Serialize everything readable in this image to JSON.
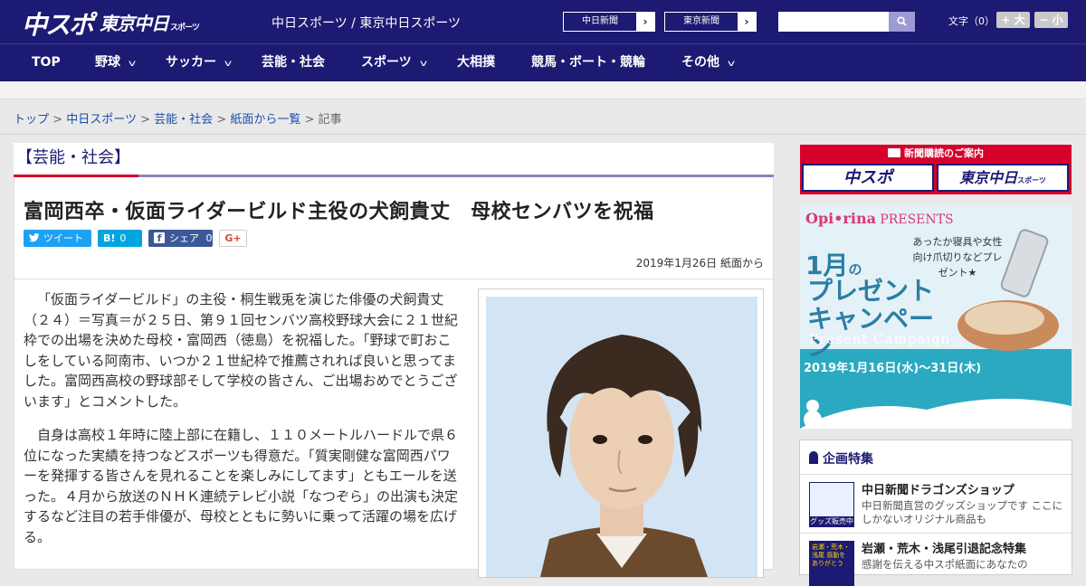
{
  "header": {
    "logo_chunichi": "中スポ",
    "logo_tokyo": "東京中日",
    "logo_tokyo_sub": "スポーツ",
    "site_name": "中日スポーツ / 東京中日スポーツ",
    "links": [
      {
        "label": "中日新聞",
        "arrow": "›"
      },
      {
        "label": "東京新聞",
        "arrow": "›"
      }
    ],
    "search_placeholder": "",
    "font_size_label": "文字（0）",
    "font_larger": "+ 大",
    "font_smaller": "− 小"
  },
  "nav": [
    {
      "label": "TOP",
      "has_menu": false
    },
    {
      "label": "野球",
      "has_menu": true
    },
    {
      "label": "サッカー",
      "has_menu": true
    },
    {
      "label": "芸能・社会",
      "has_menu": false
    },
    {
      "label": "スポーツ",
      "has_menu": true
    },
    {
      "label": "大相撲",
      "has_menu": false
    },
    {
      "label": "競馬・ボート・競輪",
      "has_menu": false
    },
    {
      "label": "その他",
      "has_menu": true
    }
  ],
  "breadcrumb": {
    "items": [
      "トップ",
      "中日スポーツ",
      "芸能・社会",
      "紙面から一覧"
    ],
    "current": "記事",
    "separator": ">"
  },
  "category_title": "【芸能・社会】",
  "article": {
    "title": "富岡西卒・仮面ライダービルド主役の犬飼貴丈　母校センバツを祝福",
    "share": {
      "tweet": {
        "icon": "twitter-bird",
        "label": "ツイート",
        "color": "#1da1f2"
      },
      "hatena": {
        "icon": "B!",
        "count": "0",
        "color": "#00a4de"
      },
      "facebook": {
        "icon": "f",
        "label": "シェア",
        "count": "0",
        "color": "#3b5998"
      },
      "gplus": {
        "label": "G+"
      }
    },
    "date": "2019年1月26日 紙面から",
    "paragraphs": [
      "「仮面ライダービルド」の主役・桐生戦兎を演じた俳優の犬飼貴丈（２４）＝写真＝が２５日、第９１回センバツ高校野球大会に２１世紀枠での出場を決めた母校・富岡西（徳島）を祝福した。「野球で町おこしをしている阿南市、いつか２１世紀枠で推薦されれば良いと思ってました。富岡西高校の野球部そして学校の皆さん、ご出場おめでとうございます」とコメントした。",
      "自身は高校１年時に陸上部に在籍し、１１０メートルハードルで県６位になった実績を持つなどスポーツも得意だ。「質実剛健な富岡西パワーを発揮する皆さんを見れることを楽しみにしてます」ともエールを送った。４月から放送のＮＨＫ連続テレビ小説「なつぞら」の出演も決定するなど注目の若手俳優が、母校とともに勢いに乗って活躍の場を広げる。"
    ]
  },
  "sidebar": {
    "subscribe": {
      "header": "新聞購読のご案内",
      "left": "中スポ",
      "right": "東京中日",
      "right_sub": "スポーツ"
    },
    "promo": {
      "brand": "Opi•rina",
      "brand_tail": "PRESENTS",
      "tagline": "あったか寝具や女性向け爪切りなどプレゼント★",
      "month": "1月",
      "month_tail": "の",
      "headline": "プレゼントキャンペーン",
      "english": "Present Campaign",
      "period": "2019年1月16日(水)〜31日(木)"
    },
    "features": {
      "heading": "企画特集",
      "items": [
        {
          "name": "中日新聞ドラゴンズショップ",
          "desc": "中日新聞直営のグッズショップです ここにしかないオリジナル商品も",
          "thumb": "グッズ販売中"
        },
        {
          "name": "岩瀬・荒木・浅尾引退記念特集",
          "desc": "感謝を伝える中スポ紙面にあなたの",
          "thumb": "岩瀬・荒木・浅尾 感動をありがとう"
        }
      ]
    }
  },
  "colors": {
    "brand_navy": "#1c1a72",
    "accent_red": "#d6002a",
    "link_blue": "#1b4fa8"
  }
}
